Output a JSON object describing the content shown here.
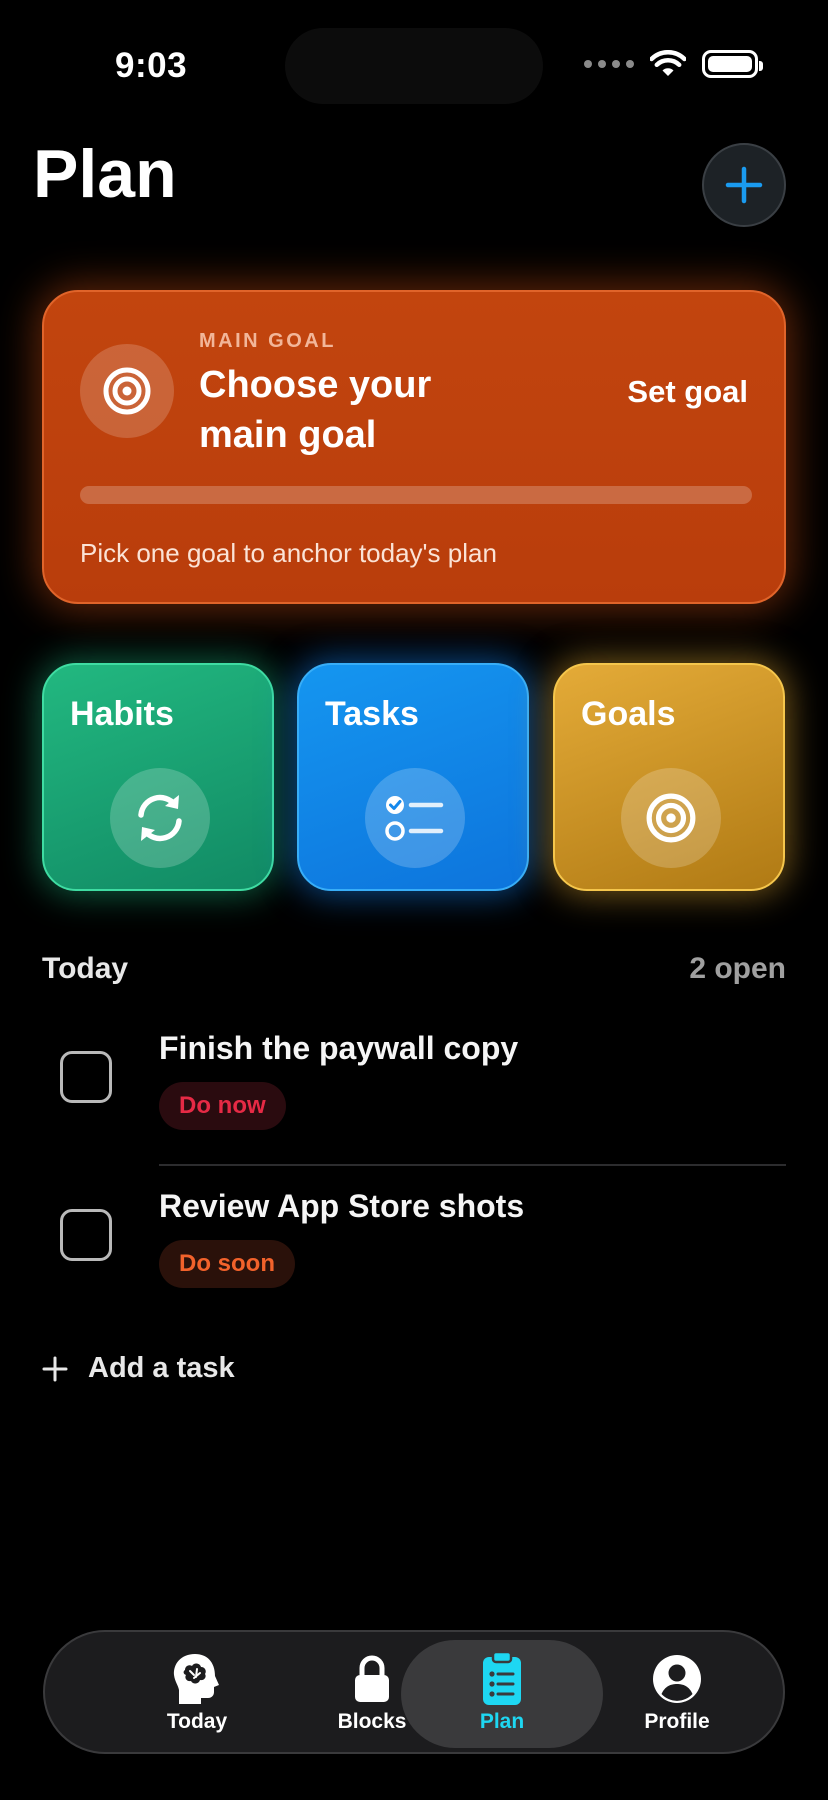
{
  "status_bar": {
    "time": "9:03"
  },
  "header": {
    "title": "Plan",
    "add_icon": "plus-icon"
  },
  "main_goal": {
    "eyebrow": "MAIN GOAL",
    "title": "Choose your main goal",
    "action": "Set goal",
    "hint": "Pick one goal to anchor today's plan",
    "progress": 0,
    "icon": "target-icon"
  },
  "categories": [
    {
      "label": "Habits",
      "icon": "sync-icon",
      "color": "#1fb37e"
    },
    {
      "label": "Tasks",
      "icon": "checklist-icon",
      "color": "#1289ea"
    },
    {
      "label": "Goals",
      "icon": "target-icon",
      "color": "#d39d2c"
    }
  ],
  "today": {
    "title": "Today",
    "count": "2 open",
    "tasks": [
      {
        "title": "Finish the paywall copy",
        "badge": "Do now",
        "badge_color": "#e52a45",
        "checked": false
      },
      {
        "title": "Review App Store shots",
        "badge": "Do soon",
        "badge_color": "#f2622b",
        "checked": false
      }
    ],
    "add_label": "Add a task"
  },
  "tabbar": {
    "items": [
      {
        "label": "Today",
        "icon": "brain-head-icon"
      },
      {
        "label": "Blocks",
        "icon": "lock-icon"
      },
      {
        "label": "Plan",
        "icon": "clipboard-list-icon",
        "active": true
      },
      {
        "label": "Profile",
        "icon": "person-circle-icon"
      }
    ],
    "active_color": "#1ed7f2"
  }
}
